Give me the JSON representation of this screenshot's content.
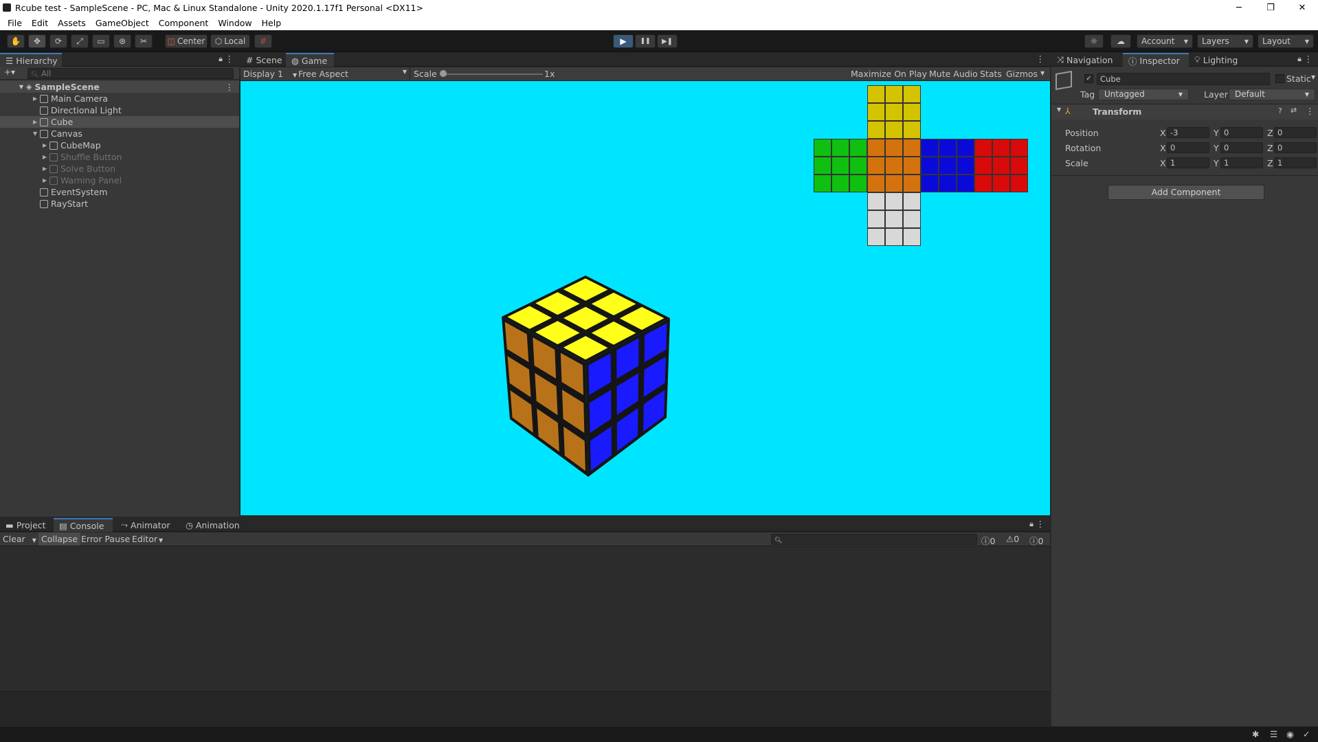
{
  "window": {
    "title": "Rcube test - SampleScene - PC, Mac & Linux Standalone - Unity 2020.1.17f1 Personal <DX11>",
    "minimize": "─",
    "restore": "❐",
    "close": "✕"
  },
  "menu": [
    "File",
    "Edit",
    "Assets",
    "GameObject",
    "Component",
    "Window",
    "Help"
  ],
  "toolbar": {
    "pivot": "Center",
    "space": "Local",
    "account": "Account",
    "layers": "Layers",
    "layout": "Layout",
    "play_icon": "▶",
    "pause_icon": "❚❚",
    "step_icon": "▶❚"
  },
  "hierarchy": {
    "tab": "Hierarchy",
    "add": "+▾",
    "search_placeholder": "All",
    "scene": "SampleScene",
    "items": [
      {
        "label": "Main Camera"
      },
      {
        "label": "Directional Light"
      },
      {
        "label": "Cube"
      },
      {
        "label": "Canvas"
      },
      {
        "label": "CubeMap"
      },
      {
        "label": "Shuffle Button"
      },
      {
        "label": "Solve Button"
      },
      {
        "label": "Warning Panel"
      },
      {
        "label": "EventSystem"
      },
      {
        "label": "RayStart"
      }
    ]
  },
  "center": {
    "tab_scene": "Scene",
    "tab_game": "Game",
    "display": "Display 1",
    "aspect": "Free Aspect",
    "scale_label": "Scale",
    "scale_value": "1x",
    "scale_level": 0,
    "maximize": "Maximize On Play",
    "mute": "Mute Audio",
    "stats": "Stats",
    "gizmos": "Gizmos"
  },
  "cubemap_colors": {
    "top": "#d4c300",
    "left": "#10c010",
    "front": "#d4730e",
    "right": "#0a0ad8",
    "back": "#d80a0a",
    "bottom": "#d8d8d8"
  },
  "cube_colors": {
    "top": "#ffff1a",
    "front": "#b8731a",
    "right": "#1a1aff"
  },
  "inspector": {
    "tab_navigation": "Navigation",
    "tab_inspector": "Inspector",
    "tab_lighting": "Lighting",
    "object_name": "Cube",
    "static_label": "Static",
    "tag_label": "Tag",
    "tag_value": "Untagged",
    "layer_label": "Layer",
    "layer_value": "Default",
    "transform": "Transform",
    "position_label": "Position",
    "rotation_label": "Rotation",
    "scale_label": "Scale",
    "axis_x": "X",
    "axis_y": "Y",
    "axis_z": "Z",
    "position": {
      "x": "-3",
      "y": "0",
      "z": "0"
    },
    "rotation": {
      "x": "0",
      "y": "0",
      "z": "0"
    },
    "scale": {
      "x": "1",
      "y": "1",
      "z": "1"
    },
    "add_component": "Add Component"
  },
  "bottom": {
    "tab_project": "Project",
    "tab_console": "Console",
    "tab_animator": "Animator",
    "tab_animation": "Animation",
    "clear": "Clear",
    "collapse": "Collapse",
    "error_pause": "Error Pause",
    "editor": "Editor",
    "count_info": "0",
    "count_warn": "0",
    "count_error": "0"
  }
}
